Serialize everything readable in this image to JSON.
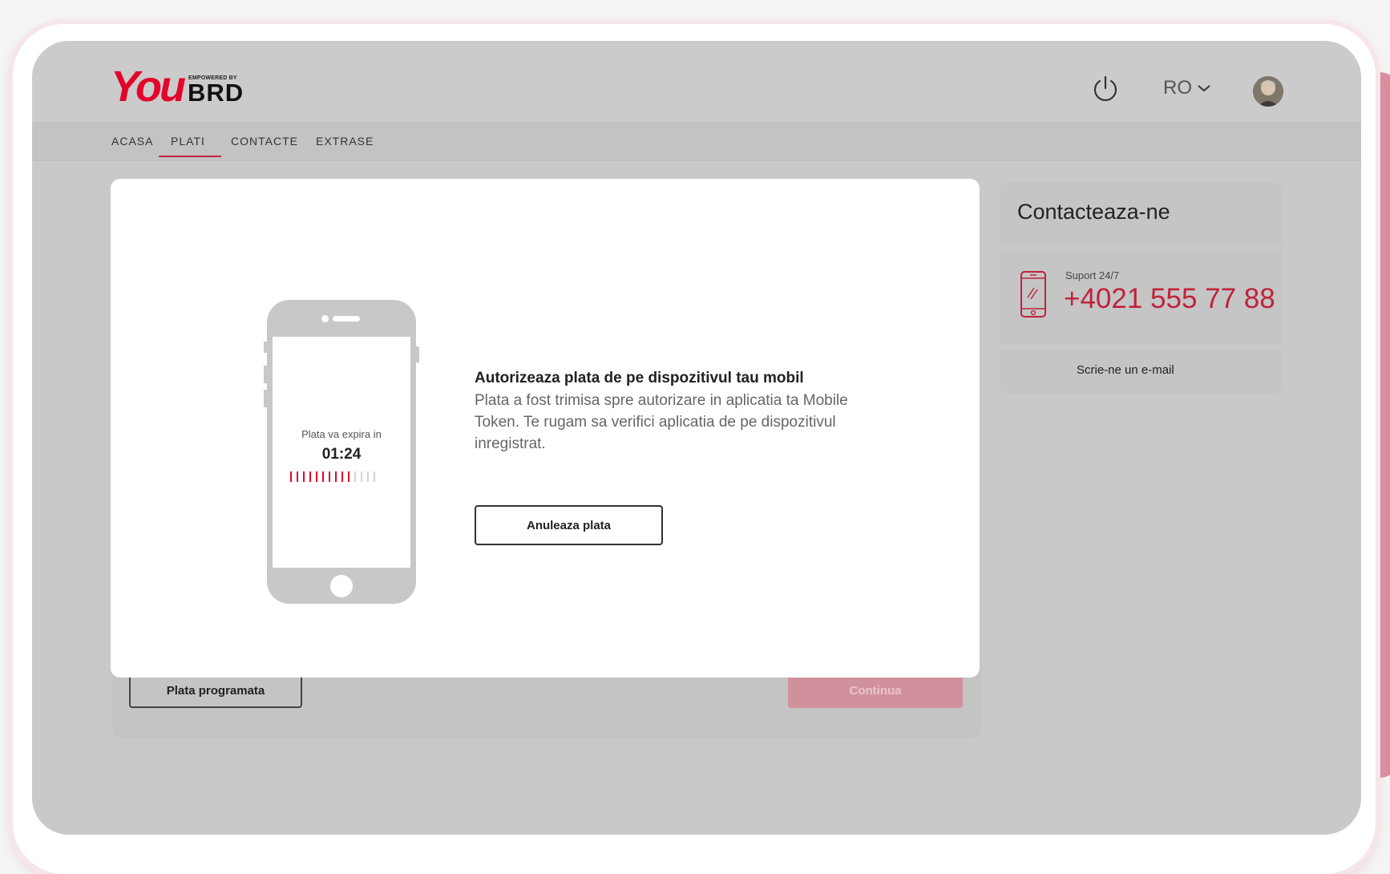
{
  "brand": {
    "logo_you": "You",
    "logo_empowered": "EMPOWERED BY",
    "logo_brd": "BRD",
    "accent": "#e2062b"
  },
  "header": {
    "language": "RO"
  },
  "nav": {
    "items": [
      {
        "label": "ACASA"
      },
      {
        "label": "PLATI",
        "active": true
      },
      {
        "label": "CONTACTE"
      },
      {
        "label": "EXTRASE"
      }
    ]
  },
  "background_form": {
    "scheduled_label": "Plata programata",
    "continue_label": "Continua"
  },
  "contact": {
    "title": "Contacteaza-ne",
    "support_label": "Suport 24/7",
    "support_number": "+4021 555 77 88",
    "email_label": "Scrie-ne un e-mail"
  },
  "modal": {
    "expire_label": "Plata va expira in",
    "timer": "01:24",
    "timer_progress": 0.7,
    "title": "Autorizeaza plata de pe dispozitivul tau mobil",
    "description": "Plata a fost trimisa spre autorizare in aplicatia ta Mobile Token. Te rugam sa verifici aplicatia de pe dispozitivul inregistrat.",
    "cancel_label": "Anuleaza plata"
  }
}
